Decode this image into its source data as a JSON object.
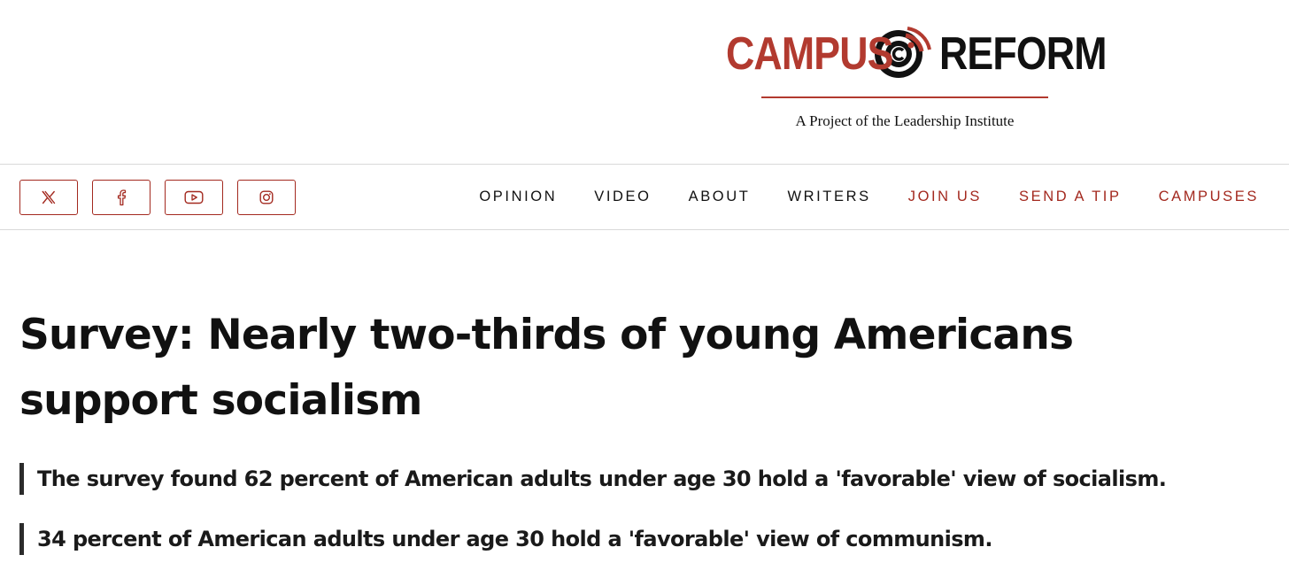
{
  "brand": {
    "word_left": "CAMPUS",
    "word_right": "REFORM",
    "tagline": "A Project of the Leadership Institute",
    "primary_color": "#b23a2f",
    "dark_color": "#111111"
  },
  "social": [
    {
      "icon": "x-icon"
    },
    {
      "icon": "facebook-icon"
    },
    {
      "icon": "youtube-icon"
    },
    {
      "icon": "instagram-icon"
    }
  ],
  "nav": {
    "items": [
      {
        "label": "OPINION"
      },
      {
        "label": "VIDEO"
      },
      {
        "label": "ABOUT"
      },
      {
        "label": "WRITERS"
      },
      {
        "label": "JOIN US"
      },
      {
        "label": "SEND A TIP"
      },
      {
        "label": "CAMPUSES"
      }
    ]
  },
  "article": {
    "headline": "Survey: Nearly two-thirds of young Americans support socialism",
    "bullets": [
      "The survey found 62 percent of American adults under age 30 hold a 'favorable' view of socialism.",
      "34 percent of American adults under age 30 hold a 'favorable' view of communism."
    ]
  }
}
